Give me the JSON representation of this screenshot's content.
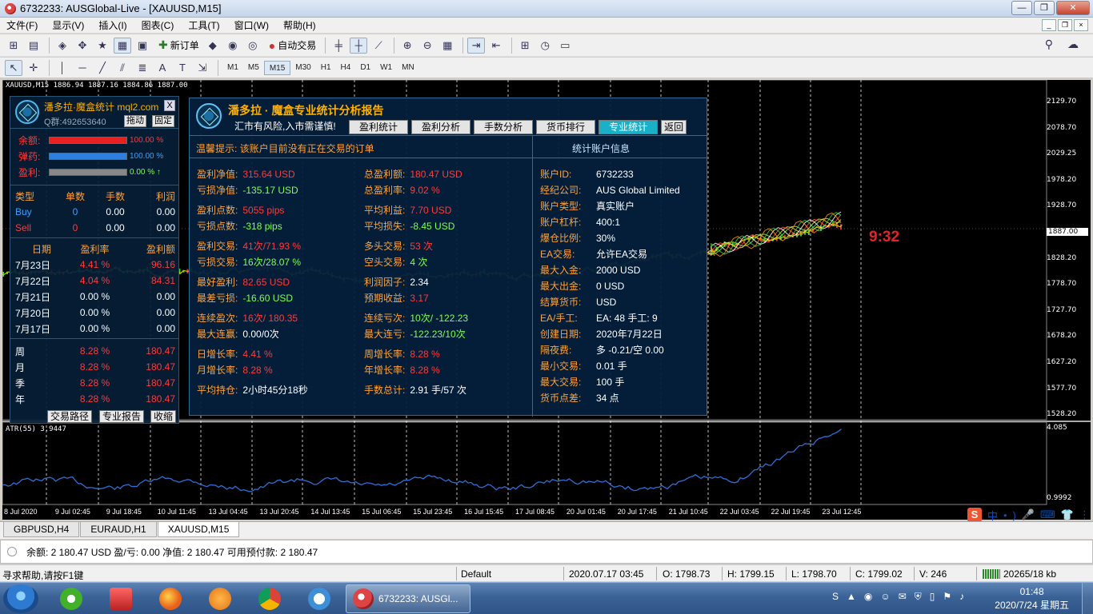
{
  "window": {
    "title": "6732233: AUSGlobal-Live - [XAUUSD,M15]",
    "controls": [
      "—",
      "❐",
      "✕"
    ],
    "mdi_controls": [
      "_",
      "❐",
      "×"
    ]
  },
  "menu": [
    "文件(F)",
    "显示(V)",
    "插入(I)",
    "图表(C)",
    "工具(T)",
    "窗口(W)",
    "帮助(H)"
  ],
  "toolbar": {
    "new_order": "新订单",
    "auto_trade": "自动交易",
    "timeframes": [
      "M1",
      "M5",
      "M15",
      "M30",
      "H1",
      "H4",
      "D1",
      "W1",
      "MN"
    ],
    "active_timeframe": "M15"
  },
  "chart": {
    "caption": "XAUUSD,M15  1886.94 1887.16 1884.86 1887.00",
    "atr_caption": "ATR(55) 3.9447",
    "countdown": "9:32",
    "price_axis": [
      "2129.70",
      "2078.70",
      "2029.25",
      "1978.20",
      "1928.70",
      "1887.00",
      "1828.20",
      "1778.70",
      "1727.70",
      "1678.20",
      "1627.20",
      "1577.70",
      "1528.20"
    ],
    "atr_axis": [
      "4.085",
      "0.9992"
    ],
    "time_axis": [
      "8 Jul 2020",
      "9 Jul 02:45",
      "9 Jul 18:45",
      "10 Jul 11:45",
      "13 Jul 04:45",
      "13 Jul 20:45",
      "14 Jul 13:45",
      "15 Jul 06:45",
      "15 Jul 23:45",
      "16 Jul 15:45",
      "17 Jul 08:45",
      "20 Jul 01:45",
      "20 Jul 17:45",
      "21 Jul 10:45",
      "22 Jul 03:45",
      "22 Jul 19:45",
      "23 Jul 12:45"
    ],
    "colors": {
      "price_line": "#c8c800",
      "bull_candle": "#3bd43b",
      "bear_candle": "#e83030",
      "atr_line": "#2f6fd8",
      "grid": "#ffffff"
    }
  },
  "left_panel": {
    "title": "潘多拉·魔盒统计 mql2.com",
    "qq": "Q群:492653640",
    "close_label": "X",
    "drag_label": "拖动",
    "fix_label": "固定",
    "bars": [
      {
        "label": "余额:",
        "value": "100.00 %",
        "color": "#e82020",
        "fill": 1.0
      },
      {
        "label": "弹药:",
        "value": "100.00 %",
        "color": "#2f7fe0",
        "fill": 1.0
      },
      {
        "label": "盈利:",
        "value": "0.00 %  ↑",
        "color": "#888888",
        "fill": 1.0
      }
    ],
    "type_header": [
      "类型",
      "单数",
      "手数",
      "利润"
    ],
    "type_rows": [
      [
        "Buy",
        "0",
        "0.00",
        "0.00"
      ],
      [
        "Sell",
        "0",
        "0.00",
        "0.00"
      ]
    ],
    "date_header": [
      "日期",
      "盈利率",
      "盈利额"
    ],
    "date_rows": [
      [
        "7月23日",
        "4.41 %",
        "96.16"
      ],
      [
        "7月22日",
        "4.04 %",
        "84.31"
      ],
      [
        "7月21日",
        "0.00 %",
        "0.00"
      ],
      [
        "7月20日",
        "0.00 %",
        "0.00"
      ],
      [
        "7月17日",
        "0.00 %",
        "0.00"
      ]
    ],
    "period_rows": [
      [
        "周",
        "8.28 %",
        "180.47"
      ],
      [
        "月",
        "8.28 %",
        "180.47"
      ],
      [
        "季",
        "8.28 %",
        "180.47"
      ],
      [
        "年",
        "8.28 %",
        "180.47"
      ]
    ],
    "bottom_buttons": [
      "交易路径",
      "专业报告",
      "收缩"
    ]
  },
  "report": {
    "title": "潘多拉 · 魔盒专业统计分析报告",
    "warning": "汇市有风险,入市需谨慎!",
    "tabs": [
      "盈利统计",
      "盈利分析",
      "手数分析",
      "货币排行",
      "专业统计",
      "返回"
    ],
    "active_tab": "专业统计",
    "notice": "温馨提示:  该账户目前没有正在交易的订单",
    "right_caption": "统计账户信息",
    "stats_left": [
      {
        "k": "盈利净值:",
        "v": "315.64 USD",
        "kc": "orange",
        "vc": "red"
      },
      {
        "k": "亏损净值:",
        "v": "-135.17 USD",
        "kc": "orange",
        "vc": "green"
      },
      {
        "k": "盈利点数:",
        "v": "5055 pips",
        "kc": "orange",
        "vc": "red"
      },
      {
        "k": "亏损点数:",
        "v": "-318 pips",
        "kc": "orange",
        "vc": "green"
      },
      {
        "k": "盈利交易:",
        "v": "41次/71.93 %",
        "kc": "orange",
        "vc": "red"
      },
      {
        "k": "亏损交易:",
        "v": "16次/28.07 %",
        "kc": "orange",
        "vc": "green"
      },
      {
        "k": "最好盈利:",
        "v": "82.65 USD",
        "kc": "orange",
        "vc": "red"
      },
      {
        "k": "最差亏损:",
        "v": "-16.60 USD",
        "kc": "orange",
        "vc": "green"
      },
      {
        "k": "连续盈次:",
        "v": "16次/ 180.35",
        "kc": "orange",
        "vc": "red"
      },
      {
        "k": "最大连赢:",
        "v": "0.00/0次",
        "kc": "orange",
        "vc": "white"
      },
      {
        "k": "日增长率:",
        "v": "4.41 %",
        "kc": "orange",
        "vc": "red"
      },
      {
        "k": "月增长率:",
        "v": "8.28 %",
        "kc": "orange",
        "vc": "red"
      },
      {
        "k": "平均持仓:",
        "v": "2小时45分18秒",
        "kc": "orange",
        "vc": "white"
      }
    ],
    "stats_mid": [
      {
        "k": "总盈利额:",
        "v": "180.47 USD",
        "kc": "orange",
        "vc": "red"
      },
      {
        "k": "总盈利率:",
        "v": "9.02 %",
        "kc": "orange",
        "vc": "red"
      },
      {
        "k": "平均利益:",
        "v": "7.70 USD",
        "kc": "orange",
        "vc": "red"
      },
      {
        "k": "平均损失:",
        "v": "-8.45 USD",
        "kc": "orange",
        "vc": "green"
      },
      {
        "k": "多头交易:",
        "v": "53 次",
        "kc": "orange",
        "vc": "red"
      },
      {
        "k": "空头交易:",
        "v": "4 次",
        "kc": "orange",
        "vc": "green"
      },
      {
        "k": "利润因子:",
        "v": "2.34",
        "kc": "orange",
        "vc": "white"
      },
      {
        "k": "预期收益:",
        "v": "3.17",
        "kc": "orange",
        "vc": "red"
      },
      {
        "k": "连续亏次:",
        "v": "10次/ -122.23",
        "kc": "orange",
        "vc": "green"
      },
      {
        "k": "最大连亏:",
        "v": "-122.23/10次",
        "kc": "orange",
        "vc": "green"
      },
      {
        "k": "周增长率:",
        "v": "8.28 %",
        "kc": "orange",
        "vc": "red"
      },
      {
        "k": "年增长率:",
        "v": "8.28 %",
        "kc": "orange",
        "vc": "red"
      },
      {
        "k": "手数总计:",
        "v": "2.91 手/57 次",
        "kc": "orange",
        "vc": "white"
      }
    ],
    "account": [
      {
        "k": "账户ID:",
        "v": "6732233"
      },
      {
        "k": "经纪公司:",
        "v": "AUS Global Limited"
      },
      {
        "k": "账户类型:",
        "v": "真实账户"
      },
      {
        "k": "账户杠杆:",
        "v": "400:1"
      },
      {
        "k": "爆仓比例:",
        "v": "30%"
      },
      {
        "k": "EA交易:",
        "v": "允许EA交易"
      },
      {
        "k": "最大入金:",
        "v": "2000 USD"
      },
      {
        "k": "最大出金:",
        "v": "0 USD"
      },
      {
        "k": "结算货币:",
        "v": "USD"
      },
      {
        "k": "EA/手工:",
        "v": "EA: 48 手工: 9"
      },
      {
        "k": "创建日期:",
        "v": "2020年7月22日"
      },
      {
        "k": "隔夜费:",
        "v": "多 -0.21/空 0.00"
      },
      {
        "k": "最小交易:",
        "v": "0.01 手"
      },
      {
        "k": "最大交易:",
        "v": "100 手"
      },
      {
        "k": "货币点差:",
        "v": "34 点"
      }
    ]
  },
  "symbol_tabs": [
    "GBPUSD,H4",
    "EURAUD,H1",
    "XAUUSD,M15"
  ],
  "active_symbol_tab": "XAUUSD,M15",
  "terminal_line": "余额: 2 180.47 USD  盈/亏: 0.00  净值: 2 180.47  可用预付款: 2 180.47",
  "ime": [
    "S",
    "中",
    "•",
    ")",
    "🎤",
    "⌨",
    "👕",
    "⋮"
  ],
  "statusbar": {
    "help": "寻求帮助,请按F1键",
    "profile": "Default",
    "datetime": "2020.07.17 03:45",
    "open": "O: 1798.73",
    "high": "H: 1799.15",
    "low": "L: 1798.70",
    "close": "C: 1799.02",
    "volume": "V: 246",
    "traffic": "20265/18 kb"
  },
  "taskbar": {
    "active_task": "6732233: AUSGl...",
    "clock_time": "01:48",
    "clock_date": "2020/7/24 星期五"
  }
}
